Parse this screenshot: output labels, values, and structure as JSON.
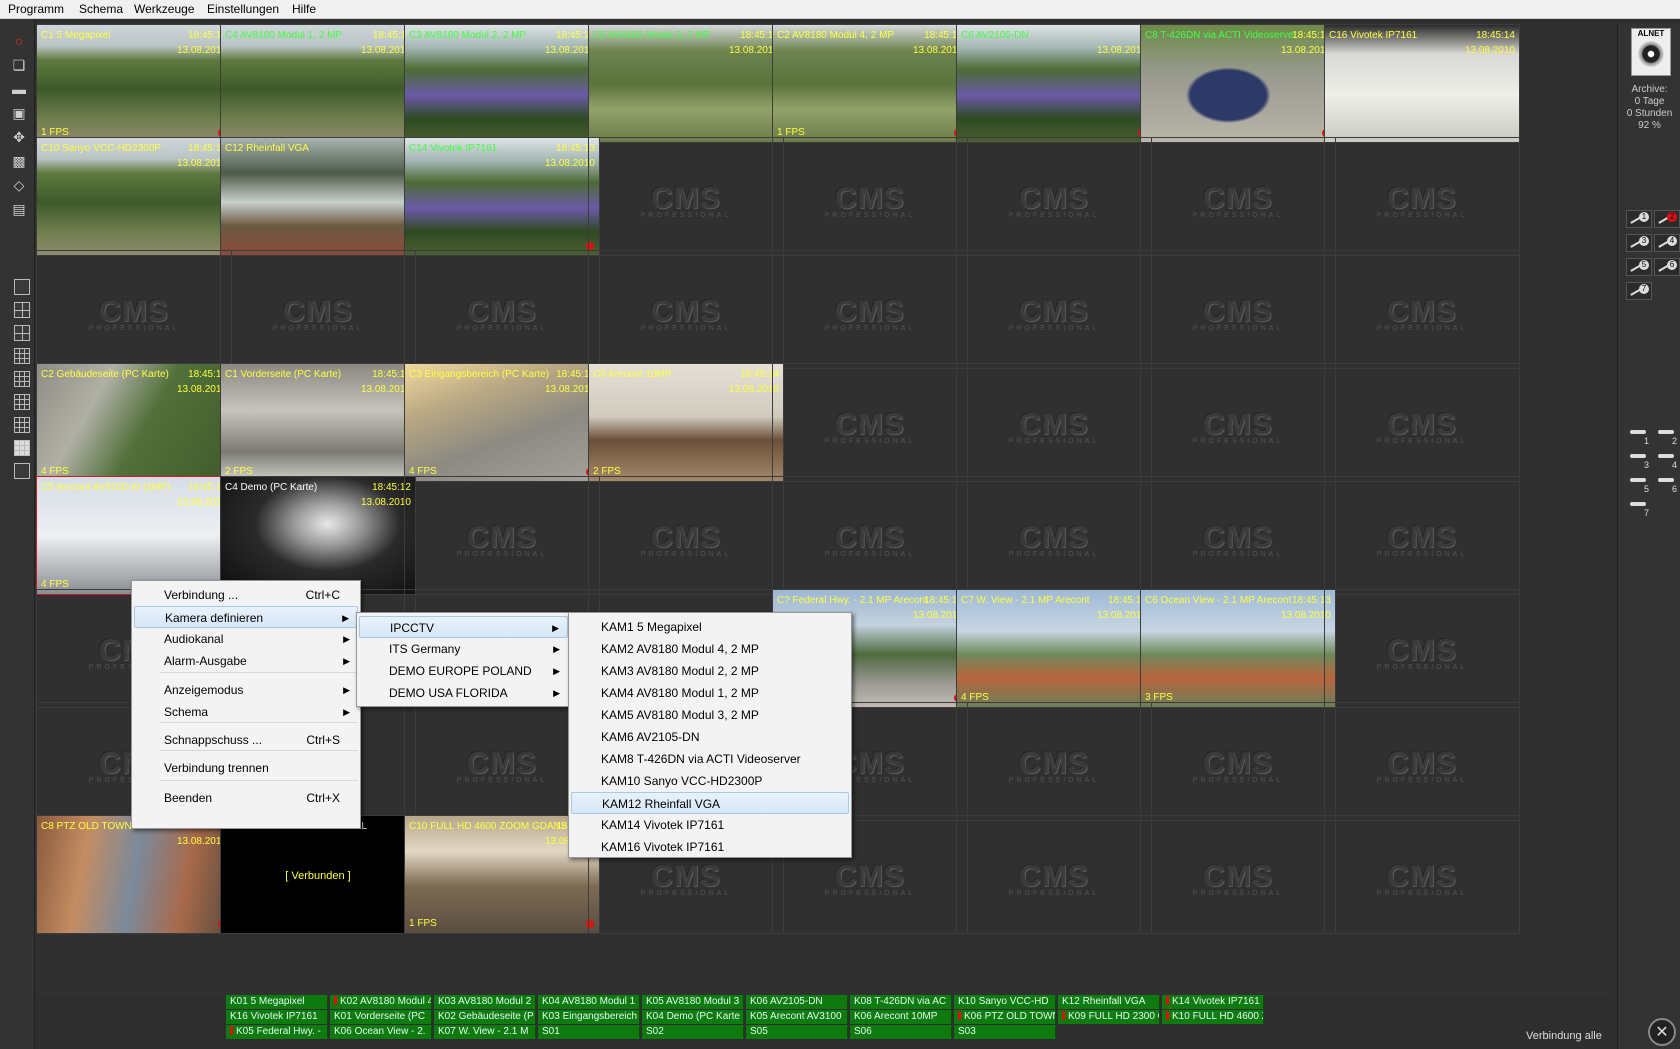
{
  "menubar": [
    "Programm",
    "Schema",
    "Werkzeuge",
    "Einstellungen",
    "Hilfe"
  ],
  "logo_placeholder": {
    "main": "CMS",
    "sub": "PROFESSIONAL"
  },
  "cameras": [
    {
      "name": "C1 5 Megapixel",
      "time": "18:45:14",
      "date": "13.08.2010",
      "fps": "1 FPS",
      "rec": true,
      "name_color": "#ffff40",
      "scene": "garden"
    },
    {
      "name": "C4 AV8180 Modul 1, 2 MP",
      "time": "18:45:11",
      "date": "13.08.2010",
      "fps": "",
      "rec": false,
      "name_color": "#40ff40",
      "scene": "garden"
    },
    {
      "name": "C3 AV8180 Modul 2, 2 MP",
      "time": "18:45:12",
      "date": "13.08.2010",
      "fps": "",
      "rec": false,
      "name_color": "#40ff40",
      "scene": "flowers"
    },
    {
      "name": "C5 AV8180 Modul 3, 2 MP",
      "time": "18:45:12",
      "date": "13.08.2010",
      "fps": "",
      "rec": false,
      "name_color": "#40ff40",
      "scene": "lawn"
    },
    {
      "name": "C2 AV8180 Modul 4, 2 MP",
      "time": "18:45:10",
      "date": "13.08.2010",
      "fps": "1 FPS",
      "rec": true,
      "name_color": "#ffff40",
      "scene": "lawn"
    },
    {
      "name": "C6 AV2105-DN",
      "time": "",
      "date": "13.08.2010",
      "fps": "",
      "rec": true,
      "name_color": "#40ff40",
      "scene": "flowers"
    },
    {
      "name": "C8 T-426DN via ACTI Videoserver",
      "time": "18:45:14",
      "date": "13.08.2010",
      "fps": "",
      "rec": true,
      "name_color": "#40ff40",
      "scene": "car"
    },
    {
      "name": "C16 Vivotek IP7161",
      "time": "18:45:14",
      "date": "13.08.2010",
      "fps": "",
      "rec": false,
      "name_color": "#ffff40",
      "scene": "sign"
    },
    {
      "name": "C10 Sanyo VCC-HD2300P",
      "time": "18:45:14",
      "date": "13.08.2010",
      "fps": "",
      "rec": false,
      "name_color": "#ffff40",
      "scene": "garden"
    },
    {
      "name": "C12 Rheinfall VGA",
      "time": "",
      "date": "",
      "fps": "",
      "rec": false,
      "name_color": "#ffff40",
      "scene": "river"
    },
    {
      "name": "C14 Vivotek IP7161",
      "time": "18:45:13",
      "date": "13.08.2010",
      "fps": "",
      "rec": true,
      "name_color": "#40ff40",
      "scene": "flowers"
    },
    {
      "name": "C2 Gebäudeseite (PC Karte)",
      "time": "18:45:13",
      "date": "13.08.2010",
      "fps": "4 FPS",
      "rec": false,
      "name_color": "#ffff40",
      "scene": "path"
    },
    {
      "name": "C1 Vorderseite (PC Karte)",
      "time": "18:45:14",
      "date": "13.08.2010",
      "fps": "2 FPS",
      "rec": false,
      "name_color": "#ffff40",
      "scene": "building"
    },
    {
      "name": "C3 Eingangsbereich (PC Karte)",
      "time": "18:45:13",
      "date": "13.08.2010",
      "fps": "4 FPS",
      "rec": true,
      "name_color": "#ffff40",
      "scene": "street"
    },
    {
      "name": "C6 Arecont 10MP",
      "time": "18:45:14",
      "date": "13.08.2010",
      "fps": "2 FPS",
      "rec": false,
      "name_color": "#ffff40",
      "scene": "office"
    },
    {
      "name": "C5 Arecont AV3100-AI (3MP)",
      "time": "18:45:14",
      "date": "13.08.2010",
      "fps": "4 FPS",
      "rec": false,
      "name_color": "#ffff40",
      "scene": "truck"
    },
    {
      "name": "C4 Demo (PC Karte)",
      "time": "18:45:12",
      "date": "13.08.2010",
      "fps": "",
      "rec": false,
      "name_color": "#ffffff",
      "scene": "mono"
    },
    {
      "name": "C? Federal Hwy. - 2.1 MP Arecont",
      "time": "18:45:14",
      "date": "13.08.2010",
      "fps": "",
      "rec": true,
      "name_color": "#ffff40",
      "scene": "palm"
    },
    {
      "name": "C7 W. View - 2.1 MP Arecont",
      "time": "18:45:14",
      "date": "13.08.2010",
      "fps": "4 FPS",
      "rec": false,
      "name_color": "#ffff40",
      "scene": "city"
    },
    {
      "name": "C6 Ocean View - 2.1 MP Arecont",
      "time": "18:45:13",
      "date": "13.08.2010",
      "fps": "3 FPS",
      "rec": false,
      "name_color": "#ffff40",
      "scene": "city"
    },
    {
      "name": "C8 PTZ OLD TOWN GDANSK PL",
      "time": "18:45:10",
      "date": "13.08.2010",
      "fps": "",
      "rec": true,
      "name_color": "#ffff40",
      "scene": "oldtown"
    },
    {
      "name": "C9 FULL HD 2300 GDANSK PL",
      "time": "",
      "date": "",
      "fps": "",
      "rec": false,
      "name_color": "#ffffff",
      "scene": "black",
      "status": "[ Verbunden ]"
    },
    {
      "name": "C10 FULL HD 4600 ZOOM GDANSK PL",
      "time": "18:45:13",
      "date": "13.08.2010",
      "fps": "1 FPS",
      "rec": true,
      "name_color": "#ffff40",
      "scene": "market"
    }
  ],
  "right_panel": {
    "logo_text": "ALNET",
    "archive_label": "Archive:",
    "archive_days": "0 Tage",
    "archive_hours": "0 Stunden",
    "archive_percent": "92 %",
    "ptz_buttons": [
      "1",
      "2",
      "3",
      "4",
      "5",
      "6",
      "7"
    ],
    "preset_buttons": [
      "1",
      "2",
      "3",
      "4",
      "5",
      "6",
      "7"
    ],
    "status": "Verbindung alle"
  },
  "tags_rows": [
    [
      {
        "t": "K01 5 Megapixel",
        "m": false
      },
      {
        "t": "K02 AV8180 Modul 4",
        "m": true
      },
      {
        "t": "K03 AV8180 Modul 2",
        "m": false
      },
      {
        "t": "K04 AV8180 Modul 1",
        "m": false
      },
      {
        "t": "K05 AV8180 Modul 3",
        "m": false
      },
      {
        "t": "K06 AV2105-DN",
        "m": false
      },
      {
        "t": "K08 T-426DN via AC",
        "m": false
      },
      {
        "t": "K10 Sanyo VCC-HD",
        "m": false
      },
      {
        "t": "K12 Rheinfall VGA",
        "m": false
      },
      {
        "t": "K14 Vivotek IP7161",
        "m": true
      }
    ],
    [
      {
        "t": "K16 Vivotek IP7161",
        "m": false
      },
      {
        "t": "K01 Vorderseite (PC",
        "m": false
      },
      {
        "t": "K02 Gebäudeseite (P",
        "m": false
      },
      {
        "t": "K03 Eingangsbereich",
        "m": false
      },
      {
        "t": "K04 Demo (PC Karte",
        "m": false
      },
      {
        "t": "K05 Arecont AV3100",
        "m": false
      },
      {
        "t": "K06 Arecont 10MP",
        "m": false
      },
      {
        "t": "K06 PTZ OLD TOWN",
        "m": true
      },
      {
        "t": "K09 FULL HD 2300 G",
        "m": true
      },
      {
        "t": "K10 FULL HD 4600 Z",
        "m": true
      }
    ],
    [
      {
        "t": "K05 Federal Hwy. -",
        "m": true
      },
      {
        "t": "K06 Ocean View - 2.",
        "m": false
      },
      {
        "t": "K07 W. View - 2.1 M",
        "m": false
      },
      {
        "t": "S01",
        "m": false
      },
      {
        "t": "S02",
        "m": false
      },
      {
        "t": "S05",
        "m": false
      },
      {
        "t": "S06",
        "m": false
      },
      {
        "t": "S03",
        "m": false
      }
    ]
  ],
  "context_menu": [
    {
      "label": "Verbindung ...",
      "shortcut": "Ctrl+C",
      "submenu": false
    },
    {
      "label": "Kamera definieren",
      "shortcut": "",
      "submenu": true,
      "highlight": true
    },
    {
      "label": "Audiokanal",
      "shortcut": "",
      "submenu": true
    },
    {
      "label": "Alarm-Ausgabe",
      "shortcut": "",
      "submenu": true
    },
    {
      "label": "Anzeigemodus",
      "shortcut": "",
      "submenu": true
    },
    {
      "label": "Schema",
      "shortcut": "",
      "submenu": true
    },
    {
      "label": "Schnappschuss ...",
      "shortcut": "Ctrl+S",
      "submenu": false
    },
    {
      "label": "Verbindung trennen",
      "shortcut": "",
      "submenu": false
    },
    {
      "label": "Beenden",
      "shortcut": "Ctrl+X",
      "submenu": false
    }
  ],
  "group_menu": [
    "IPCCTV",
    "ITS Germany",
    "DEMO EUROPE POLAND",
    "DEMO USA FLORIDA"
  ],
  "camera_menu": [
    "KAM1 5 Megapixel",
    "KAM2 AV8180 Modul 4, 2 MP",
    "KAM3 AV8180 Modul 2, 2 MP",
    "KAM4 AV8180 Modul 1, 2 MP",
    "KAM5 AV8180 Modul 3, 2 MP",
    "KAM6 AV2105-DN",
    "KAM8 T-426DN via ACTI Videoserver",
    "KAM10 Sanyo VCC-HD2300P",
    "KAM12 Rheinfall VGA",
    "KAM14 Vivotek IP7161",
    "KAM16 Vivotek IP7161"
  ],
  "camera_menu_highlight": 8,
  "colors": {
    "rec": "#e01010",
    "overlay_yellow": "#ffff40",
    "overlay_green": "#40ff40",
    "tag_green": "#0f7a0f"
  }
}
